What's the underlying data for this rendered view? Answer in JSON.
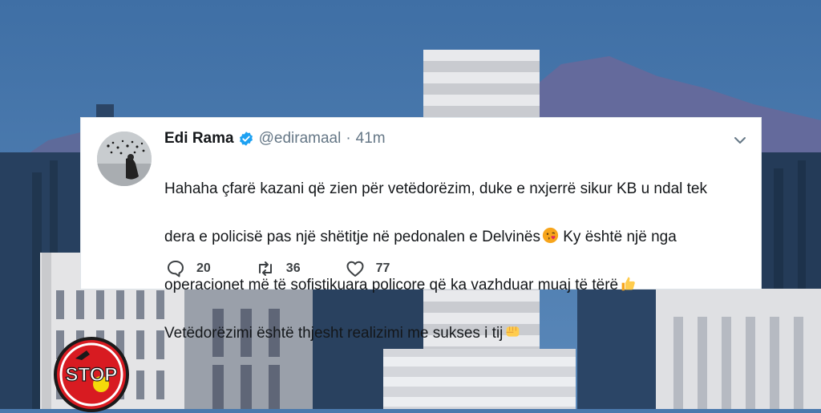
{
  "tweet": {
    "display_name": "Edi Rama",
    "handle": "@ediramaal",
    "separator": "·",
    "time": "41m",
    "line1": "Hahaha çfarë kazani që zien për vetëdorëzim, duke e nxjerrë sikur KB u ndal tek",
    "line2": "dera e policisë pas një shëtitje në pedonalen e Delvinës",
    "line2_after": " Ky është një nga",
    "line3": "operacionet më të sofistikuara policore që ka vazhduar muaj të tërë",
    "line4": "Vetëdorëzimi është thjesht realizimi me sukses i tij",
    "reply_count": "20",
    "retweet_count": "36",
    "like_count": "77",
    "icons": [
      "verified-badge-icon",
      "chevron-down-icon",
      "kiss-emoji-icon",
      "thumbs-up-emoji-icon",
      "fist-emoji-icon",
      "reply-icon",
      "retweet-icon",
      "like-icon"
    ]
  },
  "logo": {
    "text": "STOP"
  },
  "colors": {
    "sky": "#4a79ad",
    "verified": "#1da1f2",
    "card_bg": "#ffffff",
    "text": "#14171a",
    "muted": "#657786",
    "logo_red": "#d81b21"
  }
}
